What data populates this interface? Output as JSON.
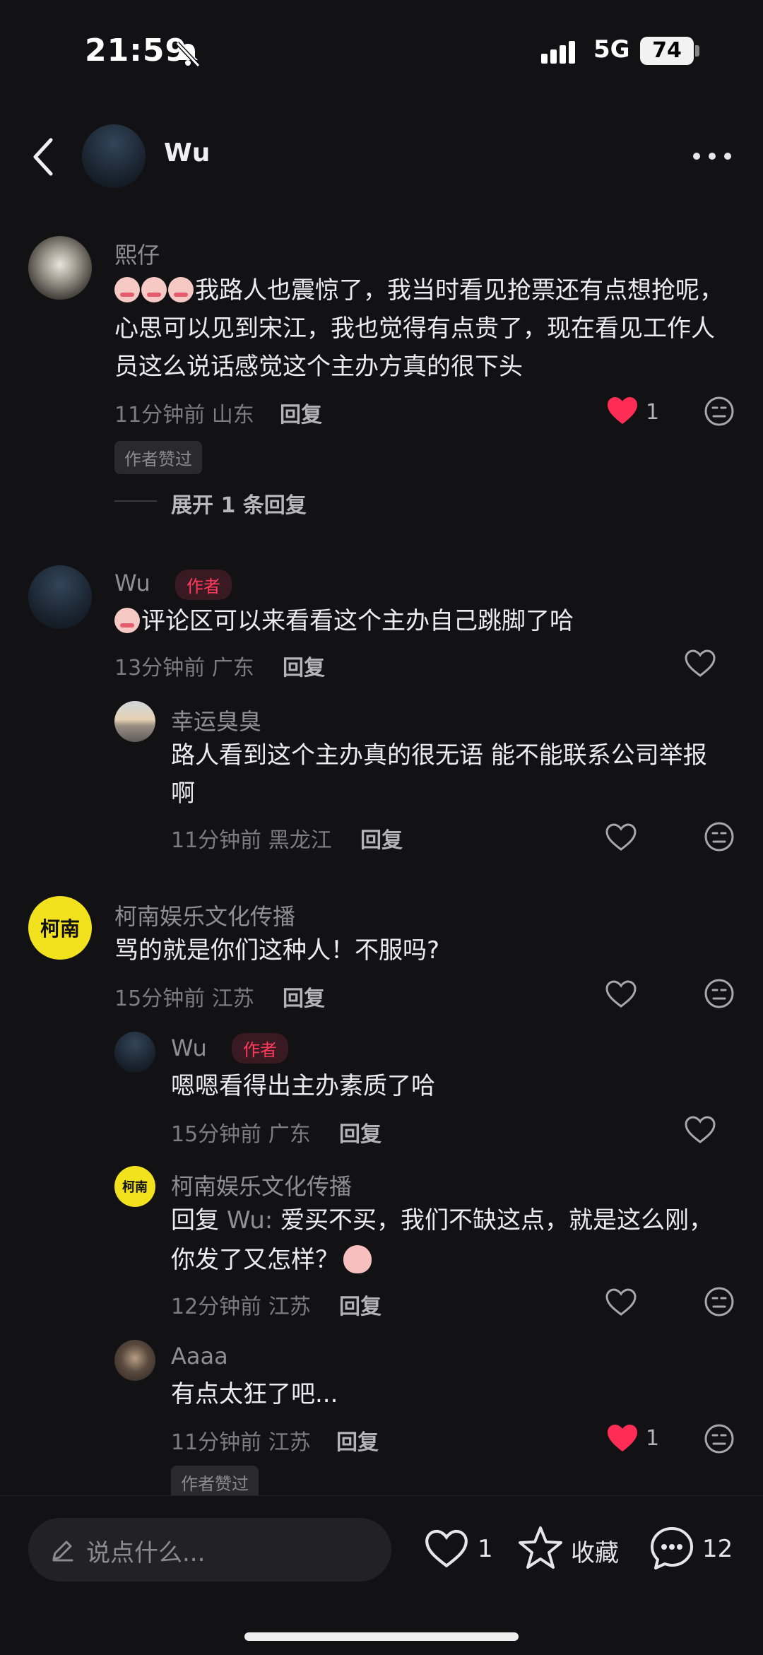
{
  "status": {
    "time": "21:59",
    "network": "5G",
    "battery": "74"
  },
  "header": {
    "name": "Wu"
  },
  "comments": [
    {
      "user": "熙仔",
      "text": "我路人也震惊了，我当时看见抢票还有点想抢呢，心思可以见到宋江，我也觉得有点贵了，现在看见工作人员这么说话感觉这个主办方真的很下头",
      "time": "11分钟前 山东",
      "reply": "回复",
      "likes": "1",
      "tag": "作者赞过",
      "expand": "展开 1 条回复"
    },
    {
      "user": "Wu",
      "author": "作者",
      "text": "评论区可以来看看这个主办自己跳脚了哈",
      "time": "13分钟前 广东",
      "reply": "回复"
    },
    {
      "user": "幸运臭臭",
      "text_line1": "路人看到这个主办真的很无语 能不能联系公司举报",
      "text_line2": "啊",
      "time": "11分钟前 黑龙江",
      "reply": "回复"
    },
    {
      "user": "柯南娱乐文化传播",
      "logo": "柯南",
      "text": "骂的就是你们这种人！不服吗?",
      "time": "15分钟前 江苏",
      "reply": "回复"
    },
    {
      "user": "Wu",
      "author": "作者",
      "text": "嗯嗯看得出主办素质了哈",
      "time": "15分钟前 广东",
      "reply": "回复"
    },
    {
      "user": "柯南娱乐文化传播",
      "logo": "柯南",
      "reply_prefix": "回复",
      "reply_to": "Wu:",
      "text_line1": "爱买不买，我们不缺这点，就是这么刚，",
      "text_line2": "你发了又怎样？",
      "time": "12分钟前 江苏",
      "reply": "回复"
    },
    {
      "user": "Aaaa",
      "text": "有点太狂了吧...",
      "time": "11分钟前 江苏",
      "reply": "回复",
      "likes": "1",
      "tag": "作者赞过"
    }
  ],
  "bottom": {
    "placeholder": "说点什么...",
    "likes": "1",
    "fav": "收藏",
    "comments": "12"
  },
  "colors": {
    "liked": "#ff2d55",
    "author": "#ff3b5b",
    "background": "#121215"
  }
}
